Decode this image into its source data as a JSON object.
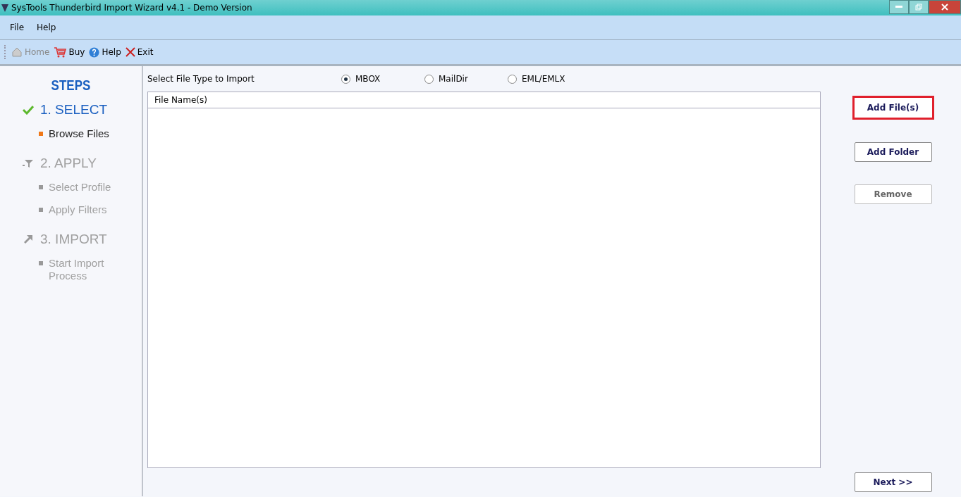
{
  "window": {
    "title": "SysTools Thunderbird Import Wizard v4.1 - Demo Version"
  },
  "menu": [
    "File",
    "Help"
  ],
  "toolbar": [
    {
      "label": "Home",
      "disabled": true
    },
    {
      "label": "Buy",
      "disabled": false
    },
    {
      "label": "Help",
      "disabled": false
    },
    {
      "label": "Exit",
      "disabled": false
    }
  ],
  "sidebar": {
    "title": "STEPS",
    "steps": [
      {
        "label": "1. SELECT",
        "done": true,
        "substeps": [
          {
            "label": "Browse Files",
            "active": true
          }
        ]
      },
      {
        "label": "2. APPLY",
        "done": false,
        "substeps": [
          {
            "label": "Select Profile",
            "active": false
          },
          {
            "label": "Apply Filters",
            "active": false
          }
        ]
      },
      {
        "label": "3. IMPORT",
        "done": false,
        "substeps": [
          {
            "label": "Start Import Process",
            "active": false
          }
        ]
      }
    ]
  },
  "file_type": {
    "label": "Select File Type to Import",
    "options": [
      {
        "label": "MBOX",
        "selected": true
      },
      {
        "label": "MailDir",
        "selected": false
      },
      {
        "label": "EML/EMLX",
        "selected": false
      }
    ]
  },
  "file_list": {
    "columns": [
      "File Name(s)"
    ]
  },
  "buttons": [
    {
      "label": "Add File(s)",
      "highlighted": true,
      "disabled": false
    },
    {
      "label": "Add Folder",
      "highlighted": false,
      "disabled": false
    },
    {
      "label": "Remove",
      "highlighted": false,
      "disabled": true
    }
  ],
  "next_button": {
    "label": "Next >>"
  }
}
